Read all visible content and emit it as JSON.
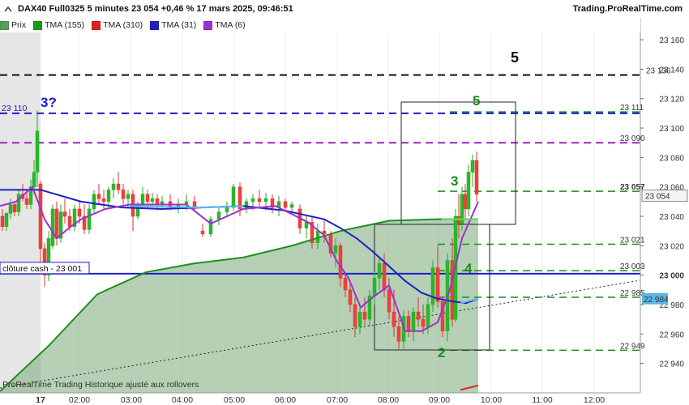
{
  "header": {
    "title": "DAX40 Full0325 5 minutes 23 054 +0,46 % 17 mars 2025, 09:46:51",
    "brand": "Trading.ProRealTime.com"
  },
  "legend": [
    {
      "label": "Prix",
      "color": "#5aa05a"
    },
    {
      "label": "TMA (155)",
      "color": "#1f9a1f"
    },
    {
      "label": "TMA (310)",
      "color": "#e02020"
    },
    {
      "label": "TMA (31)",
      "color": "#2020c0"
    },
    {
      "label": "TMA (6)",
      "color": "#a030d0"
    }
  ],
  "footer": "ProRealTime Trading  Historique ajusté aux rollovers",
  "annotations": {
    "close_cash_label": "clôture cash -  23 001",
    "left_level_label": "23 110",
    "wave_3q": "3?",
    "wave_5_black": "5",
    "wave_5_green": "5",
    "wave_3": "3",
    "wave_4": "4",
    "wave_2": "2"
  },
  "chart_data": {
    "type": "candlestick",
    "title": "DAX40 Full0325 5 minutes",
    "y_axis": {
      "range": [
        22920,
        23165
      ],
      "ticks": [
        22940,
        22960,
        22980,
        23000,
        23020,
        23040,
        23060,
        23080,
        23100,
        23120,
        23140,
        23160
      ]
    },
    "x_axis": {
      "tick_labels": [
        "17",
        "02:00",
        "03:00",
        "04:00",
        "05:00",
        "06:00",
        "07:00",
        "08:00",
        "09:00",
        "10:00",
        "11:00",
        "12:00"
      ]
    },
    "last_price": 23054,
    "ma31_last": 22984,
    "levels": [
      {
        "value": 23136,
        "label": "23 136",
        "color": "#111111"
      },
      {
        "value": 23111,
        "label": "23 111",
        "color": "#1a8a1a"
      },
      {
        "value": 23110,
        "label": "23 110",
        "color": "#1a1acc"
      },
      {
        "value": 23090,
        "label": "23 090",
        "color": "#a020c0"
      },
      {
        "value": 23057,
        "label": "23 057",
        "color": "#1a8a1a"
      },
      {
        "value": 23021,
        "label": "23 021",
        "color": "#1a8a1a"
      },
      {
        "value": 23003,
        "label": "23 003",
        "color": "#1a8a1a"
      },
      {
        "value": 23001,
        "label": "23 001",
        "color": "#1a1acc"
      },
      {
        "value": 22985,
        "label": "22 985",
        "color": "#1a8a1a"
      },
      {
        "value": 22949,
        "label": "22 949",
        "color": "#1a8a1a"
      }
    ],
    "series": [
      {
        "name": "TMA (155)",
        "x": [
          0,
          60,
          120,
          180,
          240,
          300,
          360,
          420,
          480,
          540,
          590
        ],
        "values": [
          22921,
          22952,
          22987,
          23002,
          23008,
          23012,
          23020,
          23030,
          23037,
          23038,
          23038
        ]
      },
      {
        "name": "TMA (31)",
        "x": [
          0,
          50,
          100,
          150,
          200,
          250,
          300,
          350,
          400,
          420,
          440,
          460,
          480,
          500,
          520,
          540,
          560,
          575,
          590
        ],
        "values": [
          23058,
          23058,
          23050,
          23046,
          23045,
          23046,
          23047,
          23044,
          23038,
          23032,
          23025,
          23016,
          23006,
          22996,
          22988,
          22984,
          22982,
          22981,
          22984
        ]
      },
      {
        "name": "TMA (6)",
        "x": [
          0,
          20,
          40,
          55,
          70,
          85,
          100,
          130,
          160,
          200,
          230,
          260,
          300,
          340,
          380,
          400,
          415,
          430,
          445,
          460,
          480,
          500,
          520,
          540,
          555,
          570,
          590
        ],
        "values": [
          23047,
          23050,
          23060,
          23038,
          23025,
          23032,
          23038,
          23045,
          23048,
          23048,
          23048,
          23035,
          23045,
          23047,
          23036,
          23027,
          23010,
          22998,
          22978,
          22985,
          22993,
          22962,
          22962,
          22968,
          22990,
          23025,
          23050
        ]
      }
    ],
    "candles": [
      [
        3,
        23040,
        23045,
        23030,
        23033
      ],
      [
        8,
        23033,
        23043,
        23030,
        23042
      ],
      [
        13,
        23042,
        23052,
        23038,
        23048
      ],
      [
        18,
        23048,
        23050,
        23040,
        23043
      ],
      [
        23,
        23043,
        23058,
        23040,
        23055
      ],
      [
        28,
        23055,
        23062,
        23050,
        23052
      ],
      [
        33,
        23052,
        23058,
        23045,
        23048
      ],
      [
        38,
        23048,
        23065,
        23045,
        23060
      ],
      [
        42,
        23060,
        23078,
        23055,
        23070
      ],
      [
        46,
        23070,
        23112,
        23060,
        23098
      ],
      [
        50,
        23062,
        23064,
        23008,
        23018
      ],
      [
        55,
        23018,
        23022,
        22992,
        23000
      ],
      [
        60,
        23000,
        23030,
        22996,
        23025
      ],
      [
        65,
        23020,
        23048,
        23018,
        23045
      ],
      [
        70,
        23045,
        23050,
        23020,
        23025
      ],
      [
        75,
        23025,
        23048,
        23022,
        23043
      ],
      [
        80,
        23043,
        23052,
        23035,
        23040
      ],
      [
        86,
        23040,
        23045,
        23030,
        23033
      ],
      [
        92,
        23033,
        23048,
        23030,
        23045
      ],
      [
        98,
        23045,
        23050,
        23035,
        23040
      ],
      [
        104,
        23040,
        23048,
        23028,
        23031
      ],
      [
        110,
        23031,
        23048,
        23028,
        23045
      ],
      [
        116,
        23045,
        23058,
        23042,
        23055
      ],
      [
        122,
        23055,
        23062,
        23048,
        23052
      ],
      [
        128,
        23052,
        23058,
        23045,
        23050
      ],
      [
        134,
        23050,
        23060,
        23045,
        23058
      ],
      [
        140,
        23058,
        23066,
        23052,
        23062
      ],
      [
        146,
        23062,
        23070,
        23055,
        23058
      ],
      [
        152,
        23058,
        23062,
        23048,
        23052
      ],
      [
        158,
        23052,
        23058,
        23046,
        23055
      ],
      [
        164,
        23055,
        23058,
        23030,
        23040
      ],
      [
        170,
        23040,
        23050,
        23038,
        23048
      ],
      [
        176,
        23048,
        23060,
        23045,
        23055
      ],
      [
        182,
        23055,
        23058,
        23045,
        23050
      ],
      [
        188,
        23050,
        23056,
        23046,
        23052
      ],
      [
        194,
        23052,
        23055,
        23044,
        23048
      ],
      [
        200,
        23048,
        23054,
        23044,
        23050
      ],
      [
        210,
        23050,
        23055,
        23044,
        23047
      ],
      [
        220,
        23047,
        23052,
        23042,
        23048
      ],
      [
        230,
        23048,
        23055,
        23044,
        23050
      ],
      [
        240,
        23050,
        23054,
        23044,
        23046
      ],
      [
        250,
        23030,
        23035,
        23026,
        23028
      ],
      [
        260,
        23028,
        23040,
        23026,
        23038
      ],
      [
        270,
        23038,
        23046,
        23034,
        23043
      ],
      [
        280,
        23043,
        23050,
        23040,
        23046
      ],
      [
        288,
        23046,
        23062,
        23044,
        23060
      ],
      [
        296,
        23060,
        23063,
        23040,
        23045
      ],
      [
        304,
        23045,
        23052,
        23042,
        23050
      ],
      [
        312,
        23050,
        23055,
        23044,
        23052
      ],
      [
        320,
        23052,
        23058,
        23046,
        23050
      ],
      [
        328,
        23050,
        23056,
        23044,
        23052
      ],
      [
        336,
        23052,
        23055,
        23042,
        23046
      ],
      [
        344,
        23046,
        23054,
        23040,
        23050
      ],
      [
        352,
        23050,
        23052,
        23044,
        23046
      ],
      [
        360,
        23046,
        23050,
        23042,
        23048
      ],
      [
        370,
        23045,
        23048,
        23028,
        23032
      ],
      [
        378,
        23032,
        23040,
        23025,
        23036
      ],
      [
        385,
        23036,
        23040,
        23018,
        23022
      ],
      [
        392,
        23022,
        23035,
        23018,
        23030
      ],
      [
        400,
        23030,
        23038,
        23022,
        23028
      ],
      [
        408,
        23028,
        23030,
        23012,
        23015
      ],
      [
        414,
        23015,
        23025,
        23005,
        23020
      ],
      [
        420,
        23020,
        23022,
        22992,
        22998
      ],
      [
        426,
        22998,
        23002,
        22985,
        22990
      ],
      [
        432,
        22990,
        22996,
        22975,
        22980
      ],
      [
        438,
        22980,
        22985,
        22958,
        22965
      ],
      [
        444,
        22965,
        22978,
        22960,
        22975
      ],
      [
        450,
        22975,
        22985,
        22966,
        22970
      ],
      [
        456,
        22970,
        22990,
        22965,
        22986
      ],
      [
        462,
        22986,
        23002,
        22980,
        22998
      ],
      [
        468,
        22998,
        23012,
        22990,
        23008
      ],
      [
        474,
        23008,
        23015,
        22985,
        22990
      ],
      [
        480,
        22990,
        22998,
        22970,
        22975
      ],
      [
        486,
        22975,
        22990,
        22958,
        22965
      ],
      [
        492,
        22965,
        22972,
        22950,
        22955
      ],
      [
        498,
        22955,
        22976,
        22950,
        22972
      ],
      [
        504,
        22972,
        22976,
        22958,
        22962
      ],
      [
        510,
        22962,
        22978,
        22955,
        22975
      ],
      [
        516,
        22975,
        22985,
        22965,
        22970
      ],
      [
        522,
        22970,
        22980,
        22960,
        22965
      ],
      [
        528,
        22965,
        22985,
        22960,
        22980
      ],
      [
        534,
        22980,
        23010,
        22975,
        23005
      ],
      [
        540,
        23005,
        23020,
        22978,
        22982
      ],
      [
        546,
        22982,
        22985,
        22958,
        22962
      ],
      [
        552,
        22962,
        23015,
        22955,
        23010
      ],
      [
        558,
        23010,
        23025,
        22965,
        22970
      ],
      [
        562,
        22970,
        23045,
        22968,
        23040
      ],
      [
        566,
        23040,
        23055,
        23025,
        23035
      ],
      [
        570,
        23035,
        23060,
        23030,
        23055
      ],
      [
        574,
        23055,
        23062,
        23038,
        23045
      ],
      [
        578,
        23045,
        23075,
        23040,
        23070
      ],
      [
        583,
        23070,
        23082,
        23060,
        23078
      ],
      [
        588,
        23078,
        23084,
        23050,
        23055
      ]
    ]
  }
}
